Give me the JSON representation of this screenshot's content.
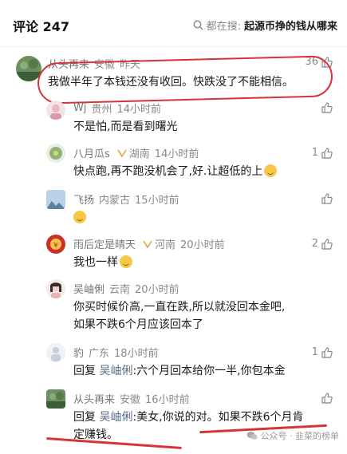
{
  "header": {
    "title": "评论 247",
    "search_prefix": "都在搜:",
    "search_keyword": "起源币挣的钱从哪来"
  },
  "comments": [
    {
      "name": "从头再来",
      "region": "安徽",
      "time": "昨天",
      "text": "我做半年了本钱还没有收回。快跌没了不能相信。",
      "likes": "36"
    },
    {
      "name": "Wj",
      "region": "贵州",
      "time": "14小时前",
      "text": "不是怕,而是看到曙光",
      "likes": ""
    },
    {
      "name": "八月瓜s",
      "region": "湖南",
      "time": "14小时前",
      "text": "快点跑,再不跑没机会了,好.让超低的上",
      "likes": "1"
    },
    {
      "name": "飞扬",
      "region": "内蒙古",
      "time": "15小时前",
      "text": "",
      "likes": ""
    },
    {
      "name": "雨后定是晴天",
      "region": "河南",
      "time": "20小时前",
      "text": "我也一样",
      "likes": "2"
    },
    {
      "name": "吴岫俐",
      "region": "云南",
      "time": "20小时前",
      "text": "你买时候价高,一直在跌,所以就没回本金吧,",
      "text2": "如果不跌6个月应该回本了",
      "likes": ""
    },
    {
      "name": "豹",
      "region": "广东",
      "time": "18小时前",
      "reply_prefix": "回复",
      "reply_to": "吴岫俐",
      "text": ":六个月回本给你一半,你包本金",
      "likes": "1"
    },
    {
      "name": "从头再来",
      "region": "安徽",
      "time": "16小时前",
      "reply_prefix": "回复",
      "reply_to": "吴岫俐",
      "text": ":美女,你说的对。如果不跌6个月肯",
      "text2": "定赚钱。",
      "likes": ""
    }
  ],
  "watermark": "公众号 · 韭菜的榜单",
  "colors": {
    "accent_red": "#d6343a",
    "reply_link": "#5a6e8c",
    "meta_gray": "#888888"
  }
}
